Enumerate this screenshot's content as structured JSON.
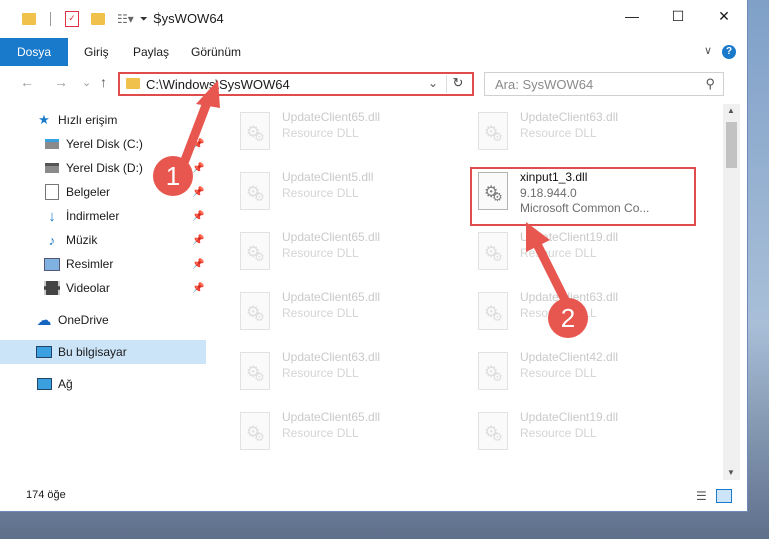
{
  "window": {
    "title": "SysWOW64",
    "controls": {
      "minimize": "—",
      "maximize": "☐",
      "close": "✕"
    }
  },
  "ribbon": {
    "tabs": [
      "Dosya",
      "Giriş",
      "Paylaş",
      "Görünüm"
    ],
    "expand_icon": "chevron-down-icon",
    "help_icon": "help-icon"
  },
  "nav": {
    "back": "←",
    "forward": "→",
    "recent": "⌄",
    "up": "↑",
    "address": "C:\\Windows\\SysWOW64",
    "search_placeholder": "Ara: SysWOW64"
  },
  "sidebar": {
    "items": [
      {
        "label": "Hızlı erişim",
        "icon": "star-icon",
        "pinned": false,
        "top": true
      },
      {
        "label": "Yerel Disk (C:)",
        "icon": "drive-icon",
        "pinned": true
      },
      {
        "label": "Yerel Disk (D:)",
        "icon": "drive-icon",
        "pinned": true
      },
      {
        "label": "Belgeler",
        "icon": "documents-icon",
        "pinned": true
      },
      {
        "label": "İndirmeler",
        "icon": "download-icon",
        "pinned": true
      },
      {
        "label": "Müzik",
        "icon": "music-icon",
        "pinned": true
      },
      {
        "label": "Resimler",
        "icon": "pictures-icon",
        "pinned": true
      },
      {
        "label": "Videolar",
        "icon": "videos-icon",
        "pinned": true
      },
      {
        "label": "OneDrive",
        "icon": "cloud-icon",
        "pinned": false,
        "top": true
      },
      {
        "label": "Bu bilgisayar",
        "icon": "computer-icon",
        "pinned": false,
        "top": true,
        "selected": true
      },
      {
        "label": "Ağ",
        "icon": "network-icon",
        "pinned": false,
        "top": true
      }
    ]
  },
  "files": [
    {
      "name": "UpdateClient65.dll",
      "desc": "Resource DLL"
    },
    {
      "name": "UpdateClient63.dll",
      "desc": "Resource DLL"
    },
    {
      "name": "UpdateClient5.dll",
      "desc": "Resource DLL"
    },
    {
      "name": "xinput1_3.dll",
      "version": "9.18.944.0",
      "desc": "Microsoft Common Co...",
      "highlighted": true
    },
    {
      "name": "UpdateClient65.dll",
      "desc": "Resource DLL"
    },
    {
      "name": "UpdateClient19.dll",
      "desc": "Resource DLL"
    },
    {
      "name": "UpdateClient65.dll",
      "desc": "Resource DLL"
    },
    {
      "name": "UpdateClient63.dll",
      "desc": "Resource DLL"
    },
    {
      "name": "UpdateClient63.dll",
      "desc": "Resource DLL"
    },
    {
      "name": "UpdateClient42.dll",
      "desc": "Resource DLL"
    },
    {
      "name": "UpdateClient65.dll",
      "desc": "Resource DLL"
    },
    {
      "name": "UpdateClient19.dll",
      "desc": "Resource DLL"
    }
  ],
  "status": {
    "count": "174 öğe"
  },
  "annotations": {
    "step1": "1",
    "step2": "2",
    "color": "#e8574f"
  }
}
